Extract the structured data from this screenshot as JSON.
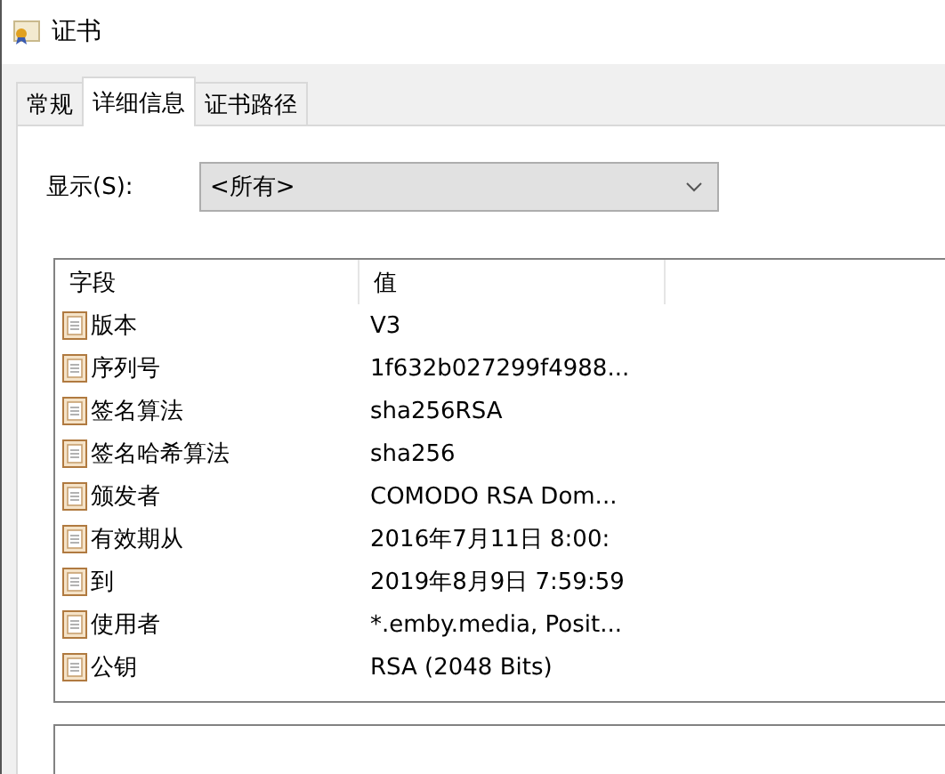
{
  "window": {
    "title": "证书"
  },
  "tabs": [
    {
      "label": "常规",
      "selected": false
    },
    {
      "label": "详细信息",
      "selected": true
    },
    {
      "label": "证书路径",
      "selected": false
    }
  ],
  "show": {
    "label": "显示(S):",
    "value": "<所有>"
  },
  "table": {
    "columns": [
      "字段",
      "值"
    ],
    "rows": [
      {
        "field": "版本",
        "value": "V3"
      },
      {
        "field": "序列号",
        "value": "1f632b027299f4988..."
      },
      {
        "field": "签名算法",
        "value": "sha256RSA"
      },
      {
        "field": "签名哈希算法",
        "value": "sha256"
      },
      {
        "field": "颁发者",
        "value": "COMODO RSA Dom..."
      },
      {
        "field": "有效期从",
        "value": "2016年7月11日 8:00:"
      },
      {
        "field": "到",
        "value": "2019年8月9日 7:59:59"
      },
      {
        "field": "使用者",
        "value": "*.emby.media, Posit..."
      },
      {
        "field": "公钥",
        "value": "RSA (2048 Bits)"
      }
    ]
  }
}
